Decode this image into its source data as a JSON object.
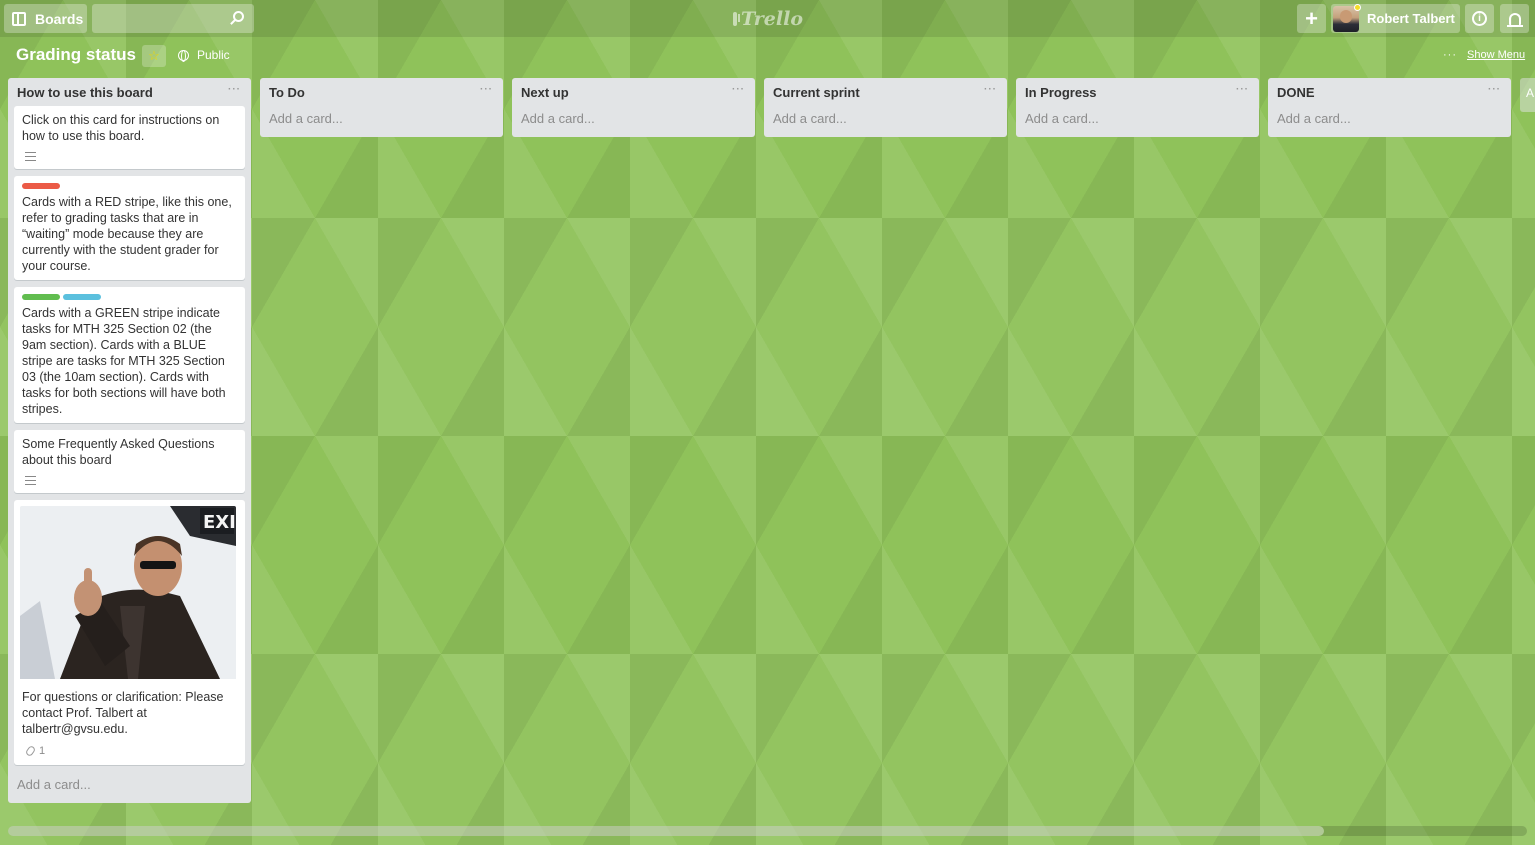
{
  "header": {
    "boards_label": "Boards",
    "search_placeholder": "",
    "logo_text": "Trello",
    "add_label": "+",
    "member_name": "Robert Talbert",
    "info_label": "i"
  },
  "board": {
    "title": "Grading status",
    "visibility": "Public",
    "show_menu_label": "Show Menu",
    "menu_dots": "···"
  },
  "lists": [
    {
      "title": "How to use this board",
      "add_card": "Add a card...",
      "cards": [
        {
          "text": "Click on this card for instructions on how to use this board.",
          "labels": [],
          "has_description": true
        },
        {
          "text": "Cards with a RED stripe, like this one, refer to grading tasks that are in “waiting” mode because they are currently with the student grader for your course.",
          "labels": [
            "#eb5a46"
          ],
          "has_description": false
        },
        {
          "text": "Cards with a GREEN stripe indicate tasks for MTH 325 Section 02 (the 9am section). Cards with a BLUE stripe are tasks for MTH 325 Section 03 (the 10am section). Cards with tasks for both sections will have both stripes.",
          "labels": [
            "#61bd4f",
            "#5bc0de"
          ],
          "has_description": false
        },
        {
          "text": "Some Frequently Asked Questions about this board",
          "labels": [],
          "has_description": true
        },
        {
          "text": "For questions or clarification: Please contact Prof. Talbert at talbertr@gvsu.edu.",
          "cover_sign_text": "EXI",
          "attachments": "1",
          "has_cover": true
        }
      ]
    },
    {
      "title": "To Do",
      "add_card": "Add a card..."
    },
    {
      "title": "Next up",
      "add_card": "Add a card..."
    },
    {
      "title": "Current sprint",
      "add_card": "Add a card..."
    },
    {
      "title": "In Progress",
      "add_card": "Add a card..."
    },
    {
      "title": "DONE",
      "add_card": "Add a card..."
    }
  ],
  "next_list_peek": "A",
  "colors": {
    "board_background": "#8fc25a",
    "star": "#f2d600",
    "label_red": "#eb5a46",
    "label_green": "#61bd4f",
    "label_blue": "#5bc0de"
  }
}
